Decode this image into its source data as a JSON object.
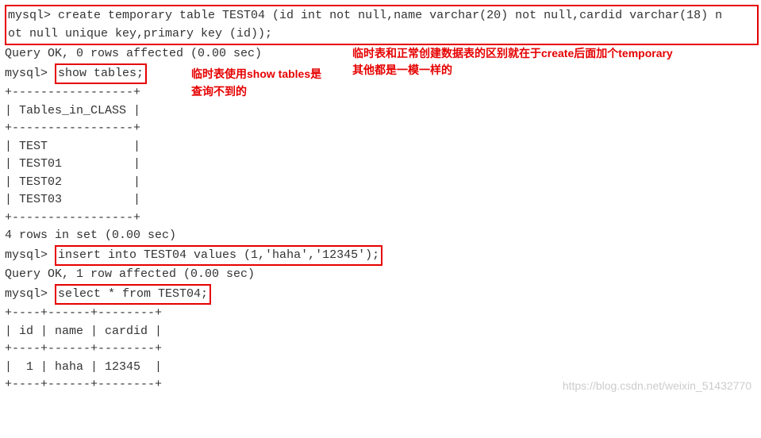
{
  "prompt": "mysql> ",
  "cmd_create": "create temporary table TEST04 (id int not null,name varchar(20) not null,cardid varchar(18) not null unique key,primary key (id));",
  "result_create": "Query OK, 0 rows affected (0.00 sec)",
  "cmd_show": "show tables;",
  "note_show_tables": "临时表使用show tables是查询不到的",
  "note_temporary": "临时表和正常创建数据表的区别就在于create后面加个temporary\n其他都是一模一样的",
  "tables_header_border": "+-----------------+",
  "tables_header": "| Tables_in_CLASS |",
  "tables_rows": [
    "| TEST            |",
    "| TEST01          |",
    "| TEST02          |",
    "| TEST03          |"
  ],
  "rows_in_set_4": "4 rows in set (0.00 sec)",
  "blank": "",
  "cmd_insert": "insert into TEST04 values (1,'haha','12345');",
  "result_insert": "Query OK, 1 row affected (0.00 sec)",
  "cmd_select": "select * from TEST04;",
  "select_border": "+----+------+--------+",
  "select_header": "| id | name | cardid |",
  "select_row": "|  1 | haha | 12345  |",
  "watermark": "https://blog.csdn.net/weixin_51432770"
}
